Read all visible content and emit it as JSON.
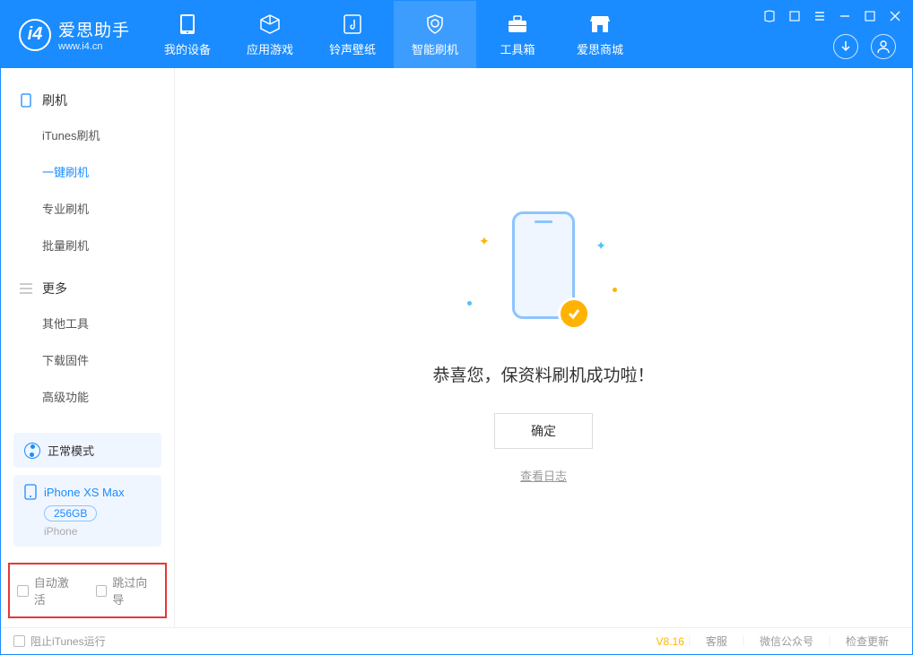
{
  "app": {
    "name": "爱思助手",
    "url": "www.i4.cn",
    "version": "V8.16"
  },
  "nav": {
    "device": "我的设备",
    "apps": "应用游戏",
    "ringtones": "铃声壁纸",
    "flash": "智能刷机",
    "toolbox": "工具箱",
    "store": "爱思商城"
  },
  "sidebar": {
    "section1": {
      "title": "刷机",
      "items": [
        "iTunes刷机",
        "一键刷机",
        "专业刷机",
        "批量刷机"
      ],
      "active_index": 1
    },
    "section2": {
      "title": "更多",
      "items": [
        "其他工具",
        "下载固件",
        "高级功能"
      ]
    },
    "mode": "正常模式",
    "device": {
      "name": "iPhone XS Max",
      "capacity": "256GB",
      "type": "iPhone"
    },
    "options": {
      "auto_activate": "自动激活",
      "skip_wizard": "跳过向导"
    }
  },
  "main": {
    "success": "恭喜您，保资料刷机成功啦！",
    "ok": "确定",
    "view_log": "查看日志"
  },
  "footer": {
    "block_itunes": "阻止iTunes运行",
    "support": "客服",
    "wechat": "微信公众号",
    "update": "检查更新"
  }
}
